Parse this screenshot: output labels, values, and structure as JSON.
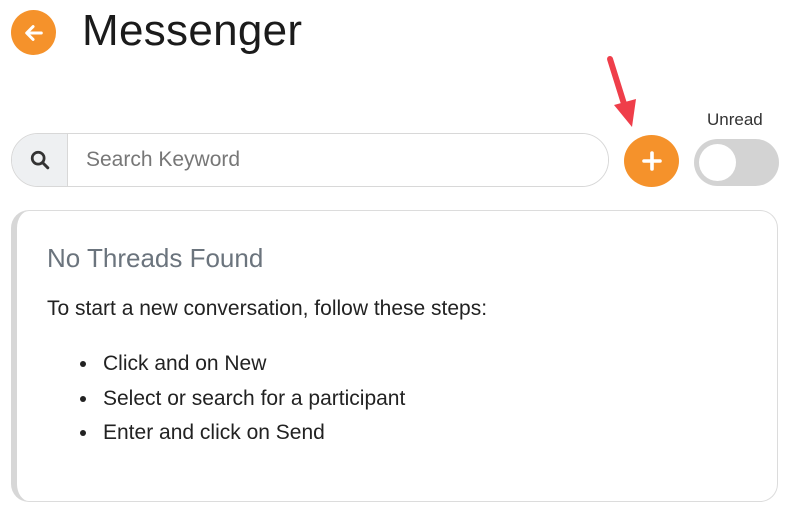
{
  "header": {
    "title": "Messenger",
    "back_icon": "arrow-left-icon"
  },
  "search": {
    "placeholder": "Search Keyword",
    "value": "",
    "icon": "search-icon"
  },
  "toolbar": {
    "new_icon": "plus-icon",
    "unread_label": "Unread",
    "unread_on": false
  },
  "threads": {
    "empty_title": "No Threads Found",
    "intro": "To start a new conversation, follow these steps:",
    "steps": [
      "Click and on New",
      "Select or search for a participant",
      "Enter and click on Send"
    ]
  },
  "colors": {
    "accent": "#f5922b",
    "annotation_arrow": "#ef3e4a",
    "toggle_off": "#d3d3d3"
  }
}
